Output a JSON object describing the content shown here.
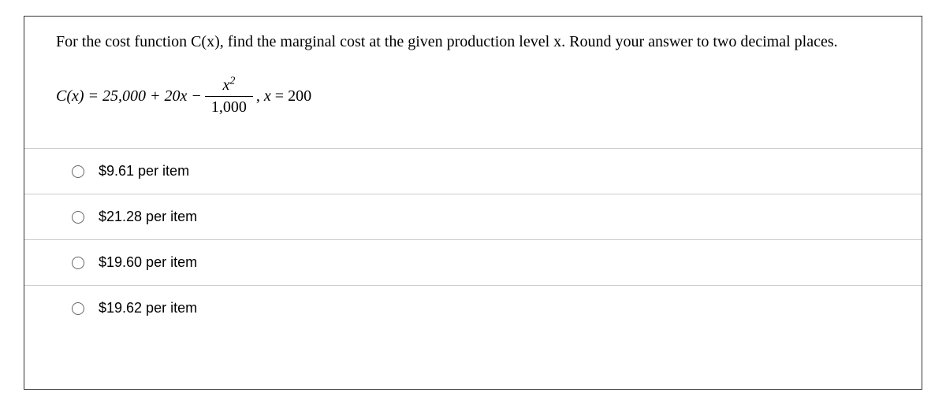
{
  "question": {
    "prompt": "For the cost function C(x), find the marginal cost at the given production level x. Round your answer to two decimal places.",
    "equation": {
      "lhs": "C(x) = 25,000 + 20x −",
      "numerator": "x",
      "numerator_exp": "2",
      "denominator": "1,000",
      "after_fraction": ", x = 200"
    }
  },
  "options": [
    {
      "label": "$9.61 per item"
    },
    {
      "label": "$21.28 per item"
    },
    {
      "label": "$19.60 per item"
    },
    {
      "label": "$19.62 per item"
    }
  ]
}
